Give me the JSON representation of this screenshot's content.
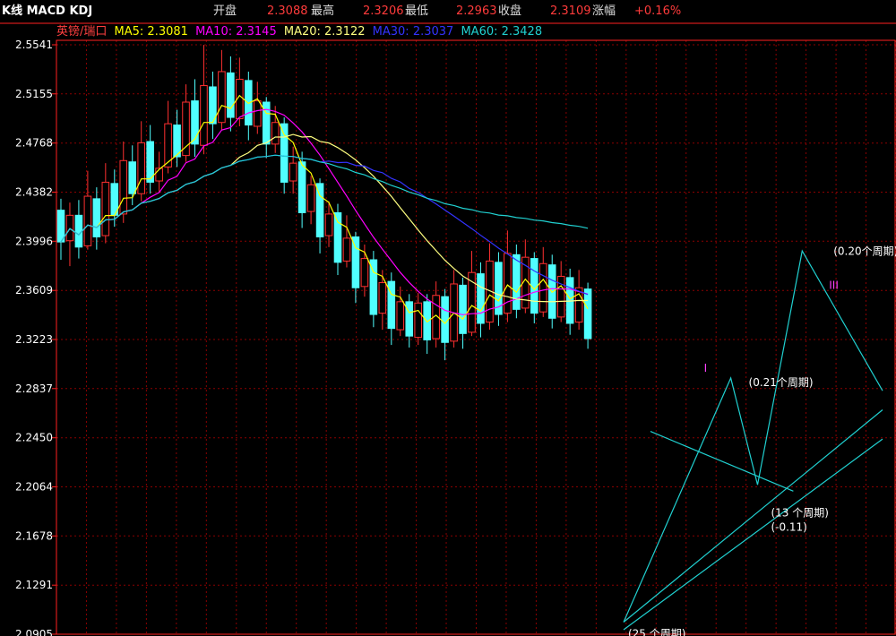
{
  "header": {
    "title": "K线 MACD KDJ",
    "open_label": "开盘",
    "open_value": "2.3088",
    "high_label": "最高",
    "high_value": "2.3206",
    "low_label": "最低",
    "low_value": "2.2963",
    "close_label": "收盘",
    "close_value": "2.3109",
    "change_label": "涨幅",
    "change_value": "+0.16%"
  },
  "ma_bar": {
    "symbol": "英镑/瑞口",
    "items": [
      {
        "label": "MA5: 2.3081",
        "color": "#ffff00"
      },
      {
        "label": "MA10: 2.3145",
        "color": "#ff00ff"
      },
      {
        "label": "MA20: 2.3122",
        "color": "#ffff80"
      },
      {
        "label": "MA30: 2.3037",
        "color": "#3333ff"
      },
      {
        "label": "MA60: 2.3428",
        "color": "#20d0d0"
      }
    ]
  },
  "chart_data": {
    "type": "line",
    "y_tick_labels": [
      "2.5541",
      "2.5155",
      "2.4768",
      "2.4382",
      "2.3996",
      "2.3609",
      "2.3223",
      "2.2837",
      "2.2450",
      "2.2064",
      "2.1678",
      "2.1291",
      "2.0905"
    ],
    "ylim": [
      2.0905,
      2.5541
    ],
    "colors": {
      "up": "#ff3030",
      "down": "#50ffff",
      "grid": "#8b0000",
      "axis": "#ff2020"
    },
    "annotations": [
      {
        "text": "I",
        "x": 72,
        "y": 2.297,
        "color": "#ff40ff"
      },
      {
        "text": "III",
        "x": 86,
        "y": 2.362,
        "color": "#ff40ff"
      },
      {
        "text": "(0.21个周期)",
        "x": 77,
        "y": 2.2855,
        "color": "#ffffff"
      },
      {
        "text": "(0.20个周期)",
        "x": 86.5,
        "y": 2.389,
        "color": "#ffffff"
      },
      {
        "text": "(13 个周期)",
        "x": 79.5,
        "y": 2.183,
        "color": "#ffffff"
      },
      {
        "text": "(-0.11)",
        "x": 79.5,
        "y": 2.172,
        "color": "#ffffff"
      },
      {
        "text": "(25 个周期)",
        "x": 63.5,
        "y": 2.088,
        "color": "#ffffff"
      }
    ],
    "trendlines": [
      {
        "points": [
          [
            63,
            2.094
          ],
          [
            92,
            2.244
          ]
        ],
        "color": "#20d0d0"
      },
      {
        "points": [
          [
            63,
            2.1
          ],
          [
            92,
            2.267
          ]
        ],
        "color": "#20d0d0"
      },
      {
        "points": [
          [
            63,
            2.1
          ],
          [
            75,
            2.292
          ],
          [
            78,
            2.208
          ],
          [
            83,
            2.392
          ],
          [
            92,
            2.282
          ]
        ],
        "color": "#20d0d0"
      },
      {
        "points": [
          [
            66,
            2.25
          ],
          [
            82,
            2.203
          ]
        ],
        "color": "#20d0d0"
      }
    ],
    "candles": [
      [
        2.424,
        2.399,
        2.433,
        2.385
      ],
      [
        2.4,
        2.42,
        2.43,
        2.38
      ],
      [
        2.42,
        2.395,
        2.432,
        2.386
      ],
      [
        2.396,
        2.435,
        2.455,
        2.393
      ],
      [
        2.433,
        2.403,
        2.442,
        2.393
      ],
      [
        2.404,
        2.446,
        2.461,
        2.398
      ],
      [
        2.445,
        2.42,
        2.456,
        2.411
      ],
      [
        2.421,
        2.463,
        2.478,
        2.414
      ],
      [
        2.462,
        2.437,
        2.475,
        2.428
      ],
      [
        2.437,
        2.477,
        2.494,
        2.431
      ],
      [
        2.478,
        2.446,
        2.491,
        2.437
      ],
      [
        2.447,
        2.457,
        2.47,
        2.438
      ],
      [
        2.458,
        2.492,
        2.51,
        2.453
      ],
      [
        2.491,
        2.466,
        2.503,
        2.458
      ],
      [
        2.467,
        2.509,
        2.523,
        2.462
      ],
      [
        2.51,
        2.476,
        2.527,
        2.466
      ],
      [
        2.475,
        2.522,
        2.554,
        2.468
      ],
      [
        2.521,
        2.492,
        2.533,
        2.48
      ],
      [
        2.493,
        2.533,
        2.55,
        2.487
      ],
      [
        2.532,
        2.497,
        2.545,
        2.486
      ],
      [
        2.496,
        2.527,
        2.544,
        2.49
      ],
      [
        2.526,
        2.491,
        2.533,
        2.479
      ],
      [
        2.49,
        2.51,
        2.525,
        2.484
      ],
      [
        2.509,
        2.476,
        2.513,
        2.465
      ],
      [
        2.476,
        2.493,
        2.506,
        2.469
      ],
      [
        2.492,
        2.446,
        2.497,
        2.437
      ],
      [
        2.447,
        2.461,
        2.474,
        2.437
      ],
      [
        2.462,
        2.422,
        2.47,
        2.41
      ],
      [
        2.423,
        2.444,
        2.451,
        2.413
      ],
      [
        2.445,
        2.403,
        2.449,
        2.39
      ],
      [
        2.404,
        2.421,
        2.431,
        2.395
      ],
      [
        2.422,
        2.383,
        2.429,
        2.373
      ],
      [
        2.384,
        2.402,
        2.42,
        2.379
      ],
      [
        2.403,
        2.363,
        2.407,
        2.351
      ],
      [
        2.364,
        2.386,
        2.397,
        2.356
      ],
      [
        2.385,
        2.342,
        2.392,
        2.332
      ],
      [
        2.343,
        2.367,
        2.377,
        2.33
      ],
      [
        2.368,
        2.331,
        2.375,
        2.318
      ],
      [
        2.33,
        2.352,
        2.364,
        2.325
      ],
      [
        2.352,
        2.325,
        2.358,
        2.316
      ],
      [
        2.324,
        2.351,
        2.359,
        2.318
      ],
      [
        2.352,
        2.322,
        2.358,
        2.311
      ],
      [
        2.323,
        2.357,
        2.368,
        2.316
      ],
      [
        2.356,
        2.32,
        2.362,
        2.306
      ],
      [
        2.321,
        2.366,
        2.377,
        2.316
      ],
      [
        2.365,
        2.327,
        2.371,
        2.315
      ],
      [
        2.328,
        2.375,
        2.392,
        2.325
      ],
      [
        2.374,
        2.335,
        2.383,
        2.324
      ],
      [
        2.336,
        2.384,
        2.398,
        2.33
      ],
      [
        2.383,
        2.342,
        2.391,
        2.333
      ],
      [
        2.343,
        2.39,
        2.408,
        2.336
      ],
      [
        2.389,
        2.346,
        2.397,
        2.339
      ],
      [
        2.347,
        2.387,
        2.401,
        2.343
      ],
      [
        2.386,
        2.343,
        2.391,
        2.335
      ],
      [
        2.344,
        2.382,
        2.395,
        2.34
      ],
      [
        2.381,
        2.339,
        2.389,
        2.331
      ],
      [
        2.34,
        2.372,
        2.384,
        2.336
      ],
      [
        2.371,
        2.335,
        2.378,
        2.326
      ],
      [
        2.336,
        2.363,
        2.377,
        2.33
      ],
      [
        2.362,
        2.323,
        2.367,
        2.315
      ]
    ]
  }
}
